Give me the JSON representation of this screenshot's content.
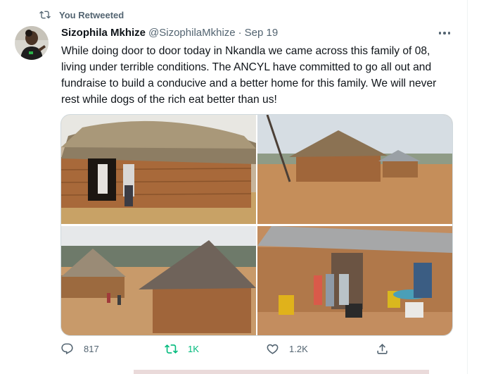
{
  "retweet_context": {
    "label": "You Retweeted",
    "icon": "retweet-icon"
  },
  "tweet": {
    "author_name": "Sizophila Mkhize",
    "author_handle": "@SizophilaMkhize",
    "separator": "·",
    "date": "Sep 19",
    "text": "While doing door to door today in Nkandla we came across this family of 08, living under terrible conditions. The ANCYL have committed to go all out and fundraise to build a conducive and a better home for this family. We will never rest while dogs of the rich eat better than us!"
  },
  "media": {
    "photos": [
      {
        "description_icon": "photo-thatched-hut-children-icon"
      },
      {
        "description_icon": "photo-round-hut-field-icon"
      },
      {
        "description_icon": "photo-huts-hillside-icon"
      },
      {
        "description_icon": "photo-family-tin-roof-house-icon"
      }
    ]
  },
  "actions": {
    "reply_count": "817",
    "retweet_count": "1K",
    "like_count": "1.2K",
    "retweeted": true,
    "retweet_color": "#00ba7c"
  },
  "colors": {
    "secondary_text": "#536471",
    "primary_text": "#0f1419",
    "border": "#cfd9de"
  }
}
